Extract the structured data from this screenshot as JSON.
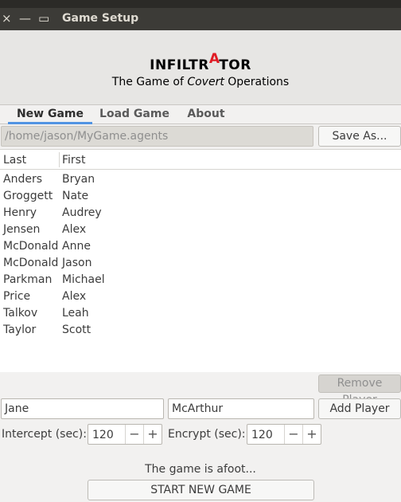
{
  "window": {
    "title": "Game Setup",
    "close_glyph": "×",
    "minimize_glyph": "—",
    "maximize_glyph": "▭"
  },
  "header": {
    "logo_pre": "INFILTR",
    "logo_red": "A",
    "logo_post": "TOR",
    "tagline_pre": "The Game of ",
    "tagline_em": "Covert",
    "tagline_post": " Operations"
  },
  "tabs": [
    {
      "label": "New Game",
      "active": true
    },
    {
      "label": "Load Game",
      "active": false
    },
    {
      "label": "About",
      "active": false
    }
  ],
  "file": {
    "path": "/home/jason/MyGame.agents",
    "save_as_label": "Save As..."
  },
  "table": {
    "columns": [
      "Last",
      "First"
    ],
    "rows": [
      [
        "Anders",
        "Bryan"
      ],
      [
        "Groggett",
        "Nate"
      ],
      [
        "Henry",
        "Audrey"
      ],
      [
        "Jensen",
        "Alex"
      ],
      [
        "McDonald",
        "Anne"
      ],
      [
        "McDonald",
        "Jason"
      ],
      [
        "Parkman",
        "Michael"
      ],
      [
        "Price",
        "Alex"
      ],
      [
        "Talkov",
        "Leah"
      ],
      [
        "Taylor",
        "Scott"
      ]
    ]
  },
  "player_form": {
    "remove_label": "Remove Player",
    "first_value": "Jane",
    "last_value": "McArthur",
    "add_label": "Add Player"
  },
  "timers": {
    "intercept_label": "Intercept (sec):",
    "intercept_value": "120",
    "encrypt_label": "Encrypt (sec):",
    "encrypt_value": "120",
    "minus_glyph": "−",
    "plus_glyph": "+"
  },
  "status_text": "The game is afoot...",
  "start_label": "START NEW GAME",
  "colors": {
    "accent": "#5294e2",
    "logo_red": "#e01b24",
    "titlebar": "#3c3b37"
  }
}
